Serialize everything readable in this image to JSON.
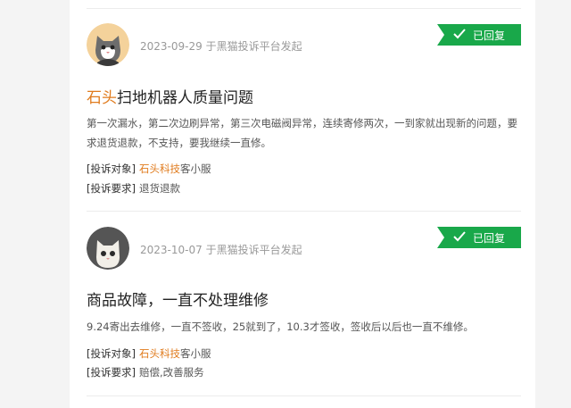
{
  "complaints": [
    {
      "date": "2023-09-29",
      "source": "于黑猫投诉平台发起",
      "status": "已回复",
      "title_brand": "石头",
      "title_rest": "扫地机器人质量问题",
      "description": "第一次漏水，第二次边刷异常，第三次电磁阀异常，连续寄修两次，一到家就出现新的问题，要求退货退款，不支持，要我继续一直修。",
      "target_label": "[投诉对象]",
      "target_org": "石头科技",
      "target_suffix": "客小服",
      "demand_label": "[投诉要求]",
      "demand_value": "退货退款"
    },
    {
      "date": "2023-10-07",
      "source": "于黑猫投诉平台发起",
      "status": "已回复",
      "title_brand": "",
      "title_rest": "商品故障，一直不处理维修",
      "description": "9.24寄出去维修，一直不签收，25就到了，10.3才签收，签收后以后也一直不维修。",
      "target_label": "[投诉对象]",
      "target_org": "石头科技",
      "target_suffix": "客小服",
      "demand_label": "[投诉要求]",
      "demand_value": "赔偿,改善服务"
    }
  ],
  "colors": {
    "accent": "#e07b1d",
    "reply_badge": "#19a84a"
  },
  "icons": {
    "status": "check-icon"
  }
}
